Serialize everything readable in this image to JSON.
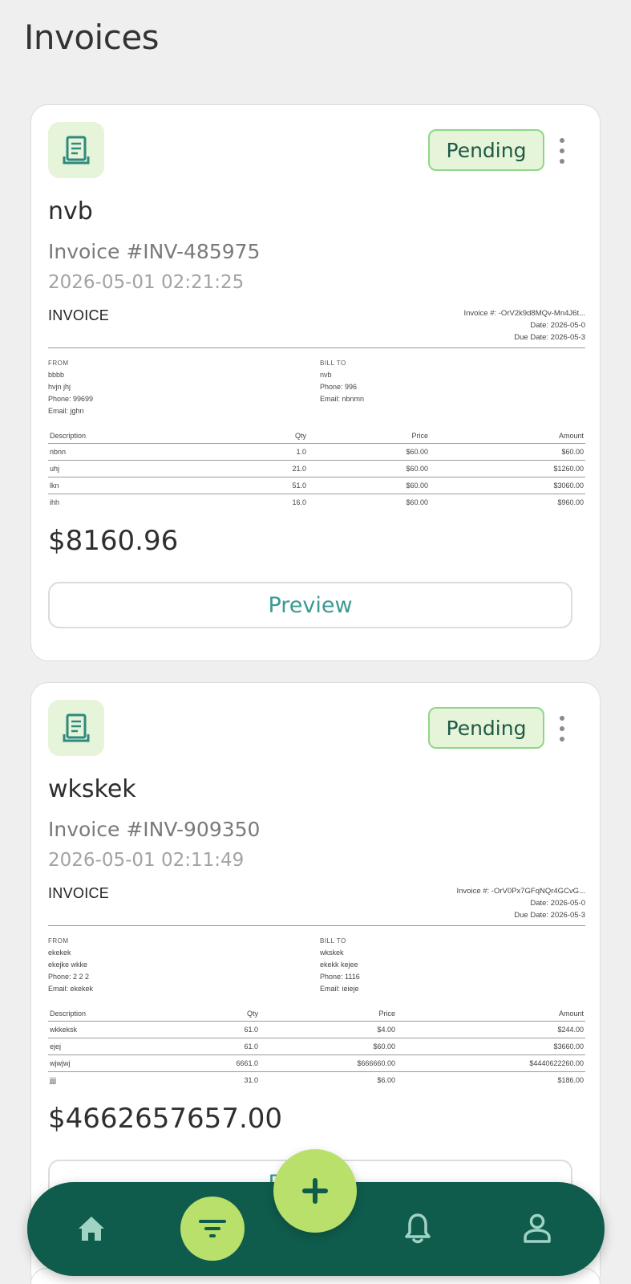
{
  "header": {
    "title": "Invoices"
  },
  "invoices": [
    {
      "customer": "nvb",
      "number": "Invoice #INV-485975",
      "datetime": "2026-05-01 02:21:25",
      "status": "Pending",
      "total": "$8160.96",
      "preview_label": "Preview",
      "doc": {
        "title": "INVOICE",
        "meta": [
          "Invoice #: -OrV2k9d8MQv-Mn4J6t...",
          "Date: 2026-05-0",
          "Due Date: 2026-05-3"
        ],
        "from_label": "FROM",
        "from": [
          "bbbb",
          "hvjn jhj",
          "Phone: 99699",
          "Email: jghn"
        ],
        "bill_to_label": "BILL TO",
        "bill_to": [
          "nvb",
          "Phone: 996",
          "Email: nbnmn"
        ],
        "columns": [
          "Description",
          "Qty",
          "Price",
          "Amount"
        ],
        "rows": [
          [
            "nbnn",
            "1.0",
            "$60.00",
            "$60.00"
          ],
          [
            "uhj",
            "21.0",
            "$60.00",
            "$1260.00"
          ],
          [
            "lkn",
            "51.0",
            "$60.00",
            "$3060.00"
          ],
          [
            "ihh",
            "16.0",
            "$60.00",
            "$960.00"
          ]
        ]
      }
    },
    {
      "customer": "wkskek",
      "number": "Invoice #INV-909350",
      "datetime": "2026-05-01 02:11:49",
      "status": "Pending",
      "total": "$4662657657.00",
      "preview_label": "Preview",
      "doc": {
        "title": "INVOICE",
        "meta": [
          "Invoice #: -OrV0Px7GFqNQr4GCvG...",
          "Date: 2026-05-0",
          "Due Date: 2026-05-3"
        ],
        "from_label": "FROM",
        "from": [
          "ekekek",
          "ekejke wkke",
          "Phone: 2 2 2",
          "Email: ekekek"
        ],
        "bill_to_label": "BILL TO",
        "bill_to": [
          "wkskek",
          "ekekk kejee",
          "Phone: 1116",
          "Email: ieieje"
        ],
        "columns": [
          "Description",
          "Qty",
          "Price",
          "Amount"
        ],
        "rows": [
          [
            "wkkeksk",
            "61.0",
            "$4.00",
            "$244.00"
          ],
          [
            "ejej",
            "61.0",
            "$60.00",
            "$3660.00"
          ],
          [
            "wjwjwj",
            "6661.0",
            "$666660.00",
            "$4440622260.00"
          ],
          [
            "jjjj",
            "31.0",
            "$6.00",
            "$186.00"
          ]
        ]
      }
    }
  ],
  "nav": {
    "items": [
      "home-icon",
      "filter-icon",
      "add-icon",
      "bell-icon",
      "profile-icon"
    ],
    "accent": "#b8e06a",
    "bar_color": "#0f5c4c"
  },
  "colors": {
    "status_bg": "#e6f4d9",
    "status_border": "#8fd68a",
    "status_text": "#1d5a45",
    "preview_text": "#3a9a90"
  }
}
